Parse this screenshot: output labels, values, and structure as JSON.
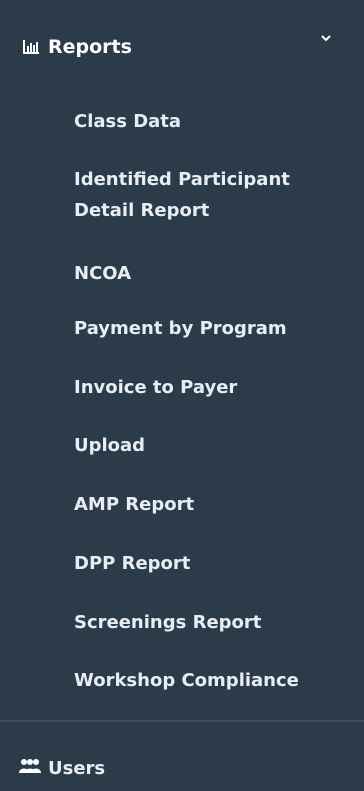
{
  "sidebar": {
    "reports": {
      "icon": "bar-chart-icon",
      "label": "Reports",
      "expand_icon": "chevron-down-icon",
      "items": [
        {
          "label": "Class Data"
        },
        {
          "label": "Identified Participant Detail Report"
        },
        {
          "label": "NCOA"
        },
        {
          "label": "Payment by Program"
        },
        {
          "label": "Invoice to Payer"
        },
        {
          "label": "Upload"
        },
        {
          "label": "AMP Report"
        },
        {
          "label": "DPP Report"
        },
        {
          "label": "Screenings Report"
        },
        {
          "label": "Workshop Compliance"
        }
      ]
    },
    "users": {
      "icon": "users-icon",
      "label": "Users"
    }
  }
}
